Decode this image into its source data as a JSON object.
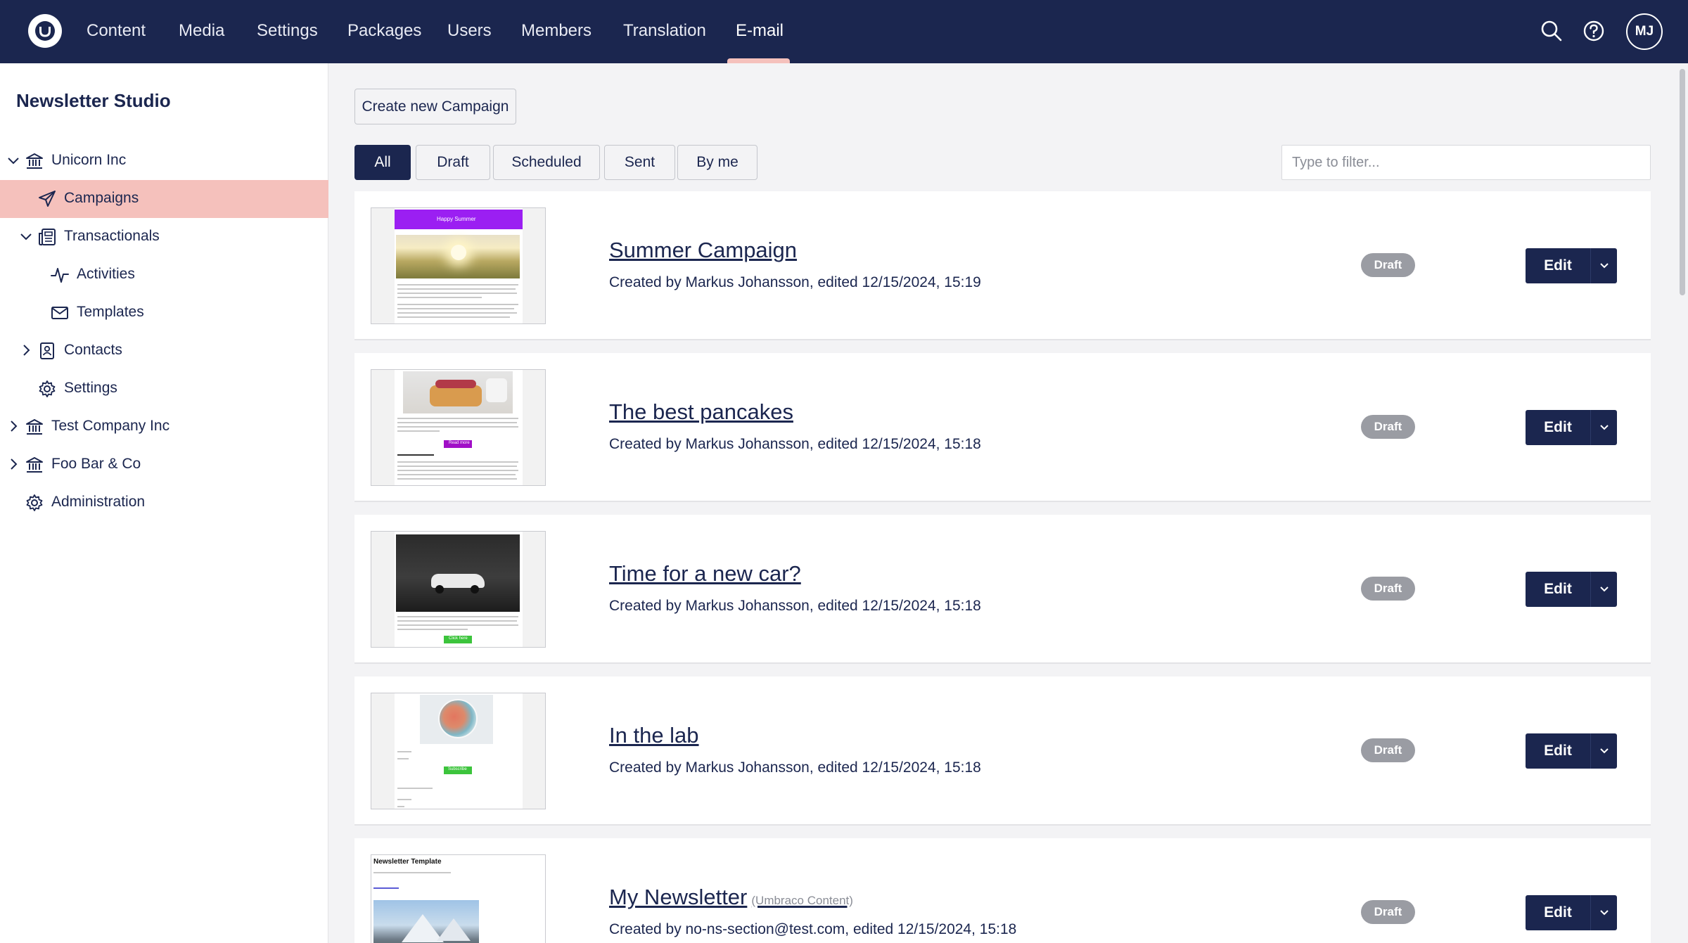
{
  "topnav": {
    "items": [
      "Content",
      "Media",
      "Settings",
      "Packages",
      "Users",
      "Members",
      "Translation",
      "E-mail"
    ],
    "active": "E-mail",
    "user_initials": "MJ"
  },
  "sidebar": {
    "title": "Newsletter Studio",
    "tree": [
      {
        "label": "Unicorn Inc",
        "icon": "building-icon",
        "expanded": true
      },
      {
        "label": "Campaigns",
        "icon": "paper-plane-icon",
        "selected": true
      },
      {
        "label": "Transactionals",
        "icon": "newspaper-icon",
        "expanded": true
      },
      {
        "label": "Activities",
        "icon": "activity-icon"
      },
      {
        "label": "Templates",
        "icon": "envelope-icon"
      },
      {
        "label": "Contacts",
        "icon": "contact-book-icon",
        "expanded": false
      },
      {
        "label": "Settings",
        "icon": "gear-icon"
      },
      {
        "label": "Test Company Inc",
        "icon": "building-icon",
        "expanded": false
      },
      {
        "label": "Foo Bar & Co",
        "icon": "building-icon",
        "expanded": false
      },
      {
        "label": "Administration",
        "icon": "gear-icon"
      }
    ]
  },
  "main": {
    "create_button": "Create new Campaign",
    "filters": [
      "All",
      "Draft",
      "Scheduled",
      "Sent",
      "By me"
    ],
    "active_filter": "All",
    "filter_placeholder": "Type to filter...",
    "campaigns": [
      {
        "title": "Summer Campaign",
        "source": "",
        "meta": "Created by Markus Johansson, edited 12/15/2024, 15:19",
        "status": "Draft",
        "edit": "Edit",
        "thumb_header": "Happy Summer"
      },
      {
        "title": "The best pancakes",
        "source": "",
        "meta": "Created by Markus Johansson, edited 12/15/2024, 15:18",
        "status": "Draft",
        "edit": "Edit",
        "thumb_button": "Read more"
      },
      {
        "title": "Time for a new car?",
        "source": "",
        "meta": "Created by Markus Johansson, edited 12/15/2024, 15:18",
        "status": "Draft",
        "edit": "Edit",
        "thumb_button": "Click here"
      },
      {
        "title": "In the lab",
        "source": "",
        "meta": "Created by Markus Johansson, edited 12/15/2024, 15:18",
        "status": "Draft",
        "edit": "Edit",
        "thumb_button": "Subscribe"
      },
      {
        "title": "My Newsletter",
        "source": "(Umbraco Content)",
        "meta": "Created by no-ns-section@test.com, edited 12/15/2024, 15:18",
        "status": "Draft",
        "edit": "Edit",
        "thumb_header": "Newsletter Template"
      }
    ]
  },
  "colors": {
    "topbar": "#1b264f",
    "accent_pink": "#f5c1bc",
    "draft_badge": "#9a9ca3"
  }
}
